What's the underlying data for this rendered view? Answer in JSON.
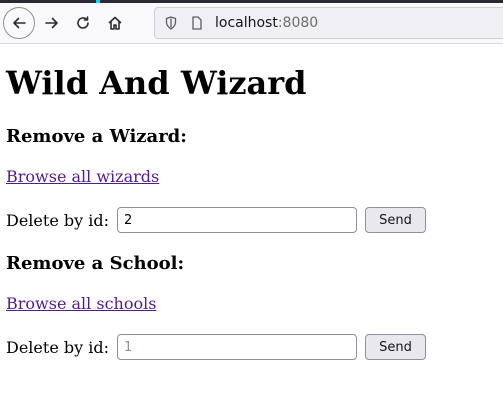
{
  "browser": {
    "url_host": "localhost",
    "url_port": ":8080"
  },
  "page": {
    "title": "Wild And Wizard",
    "wizard_section": {
      "heading": "Remove a Wizard:",
      "browse_link": "Browse all wizards",
      "delete_label": "Delete by id:",
      "input_value": "2",
      "send_label": "Send"
    },
    "school_section": {
      "heading": "Remove a School:",
      "browse_link": "Browse all schools",
      "delete_label": "Delete by id:",
      "input_placeholder": "1",
      "send_label": "Send"
    }
  }
}
